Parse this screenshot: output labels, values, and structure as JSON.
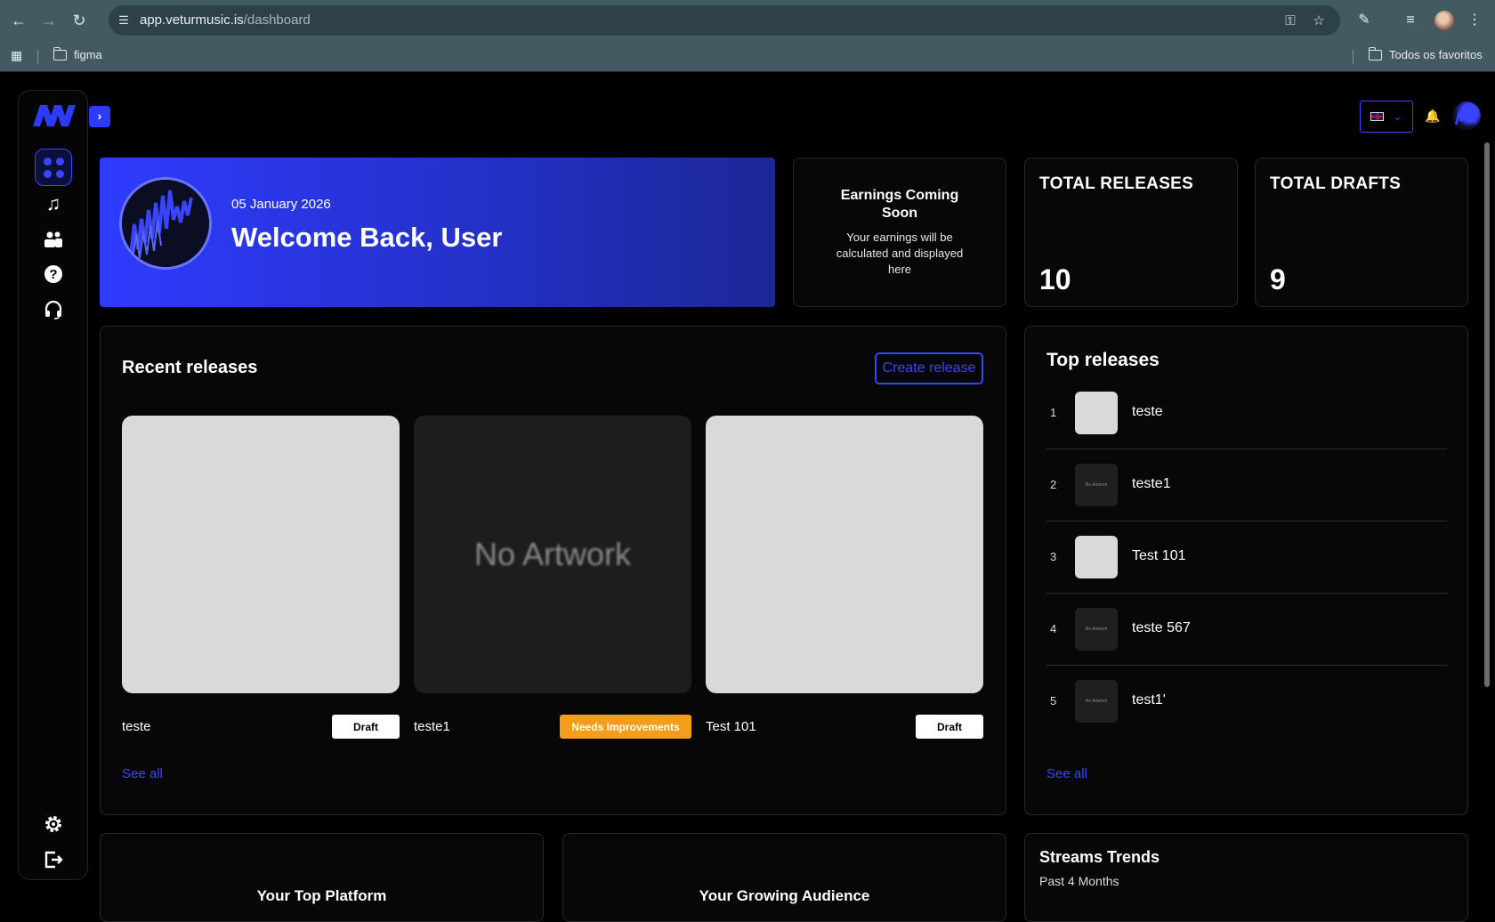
{
  "browser": {
    "url_domain": "app.veturmusic.is",
    "url_path": "/dashboard",
    "bookmark_folder": "figma",
    "all_bookmarks": "Todos os favoritos"
  },
  "header": {
    "language_flag": "uk-flag-icon",
    "accent_color": "#2d3bff"
  },
  "welcome": {
    "date": "05 January 2026",
    "title": "Welcome Back, User"
  },
  "earnings": {
    "title": "Earnings Coming Soon",
    "body": "Your earnings will be calculated and displayed here"
  },
  "stats": {
    "total_releases_label": "TOTAL RELEASES",
    "total_releases_value": "10",
    "total_drafts_label": "TOTAL DRAFTS",
    "total_drafts_value": "9"
  },
  "recent_releases": {
    "title": "Recent releases",
    "create_label": "Create release",
    "see_all": "See all",
    "items": [
      {
        "name": "teste",
        "status": "Draft",
        "artwork": ""
      },
      {
        "name": "teste1",
        "status": "Needs Improvements",
        "artwork": "No Artwork"
      },
      {
        "name": "Test 101",
        "status": "Draft",
        "artwork": ""
      }
    ]
  },
  "top_releases": {
    "title": "Top releases",
    "see_all": "See all",
    "items": [
      {
        "rank": "1",
        "name": "teste",
        "thumb": ""
      },
      {
        "rank": "2",
        "name": "teste1",
        "thumb": "No Artwork"
      },
      {
        "rank": "3",
        "name": "Test 101",
        "thumb": ""
      },
      {
        "rank": "4",
        "name": "teste 567",
        "thumb": "No Artwork"
      },
      {
        "rank": "5",
        "name": "test1'",
        "thumb": "No Artwork"
      }
    ]
  },
  "bottom": {
    "top_platform": "Your Top Platform",
    "growing_audience": "Your Growing Audience",
    "streams_trends_title": "Streams Trends",
    "streams_trends_subtitle": "Past 4 Months"
  }
}
